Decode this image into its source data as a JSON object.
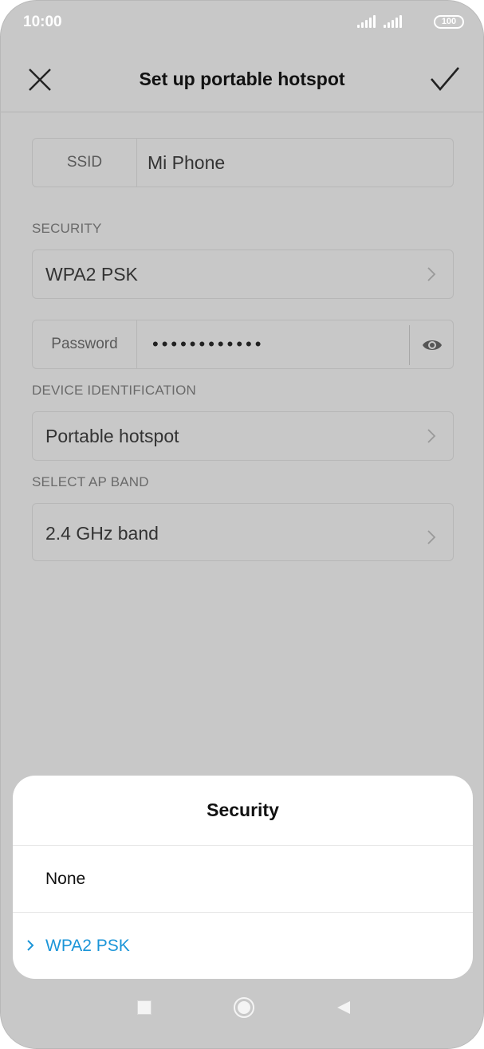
{
  "status_bar": {
    "time": "10:00",
    "battery": "100"
  },
  "header": {
    "title": "Set up portable hotspot"
  },
  "form": {
    "ssid": {
      "label": "SSID",
      "value": "Mi Phone"
    },
    "security_section": "SECURITY",
    "security_value": "WPA2 PSK",
    "password": {
      "label": "Password",
      "value": "••••••••••••"
    },
    "device_section": "DEVICE IDENTIFICATION",
    "device_value": "Portable hotspot",
    "band_section": "SELECT AP BAND",
    "band_value": "2.4 GHz band"
  },
  "sheet": {
    "title": "Security",
    "options": [
      {
        "label": "None",
        "selected": false
      },
      {
        "label": "WPA2 PSK",
        "selected": true
      }
    ]
  },
  "colors": {
    "accent": "#1b95d8",
    "dim_background": "#c8c8c8"
  },
  "icons": [
    "close-icon",
    "check-icon",
    "chevron-right-icon",
    "eye-icon",
    "chevron-right-icon",
    "square-icon",
    "circle-icon",
    "triangle-back-icon"
  ]
}
